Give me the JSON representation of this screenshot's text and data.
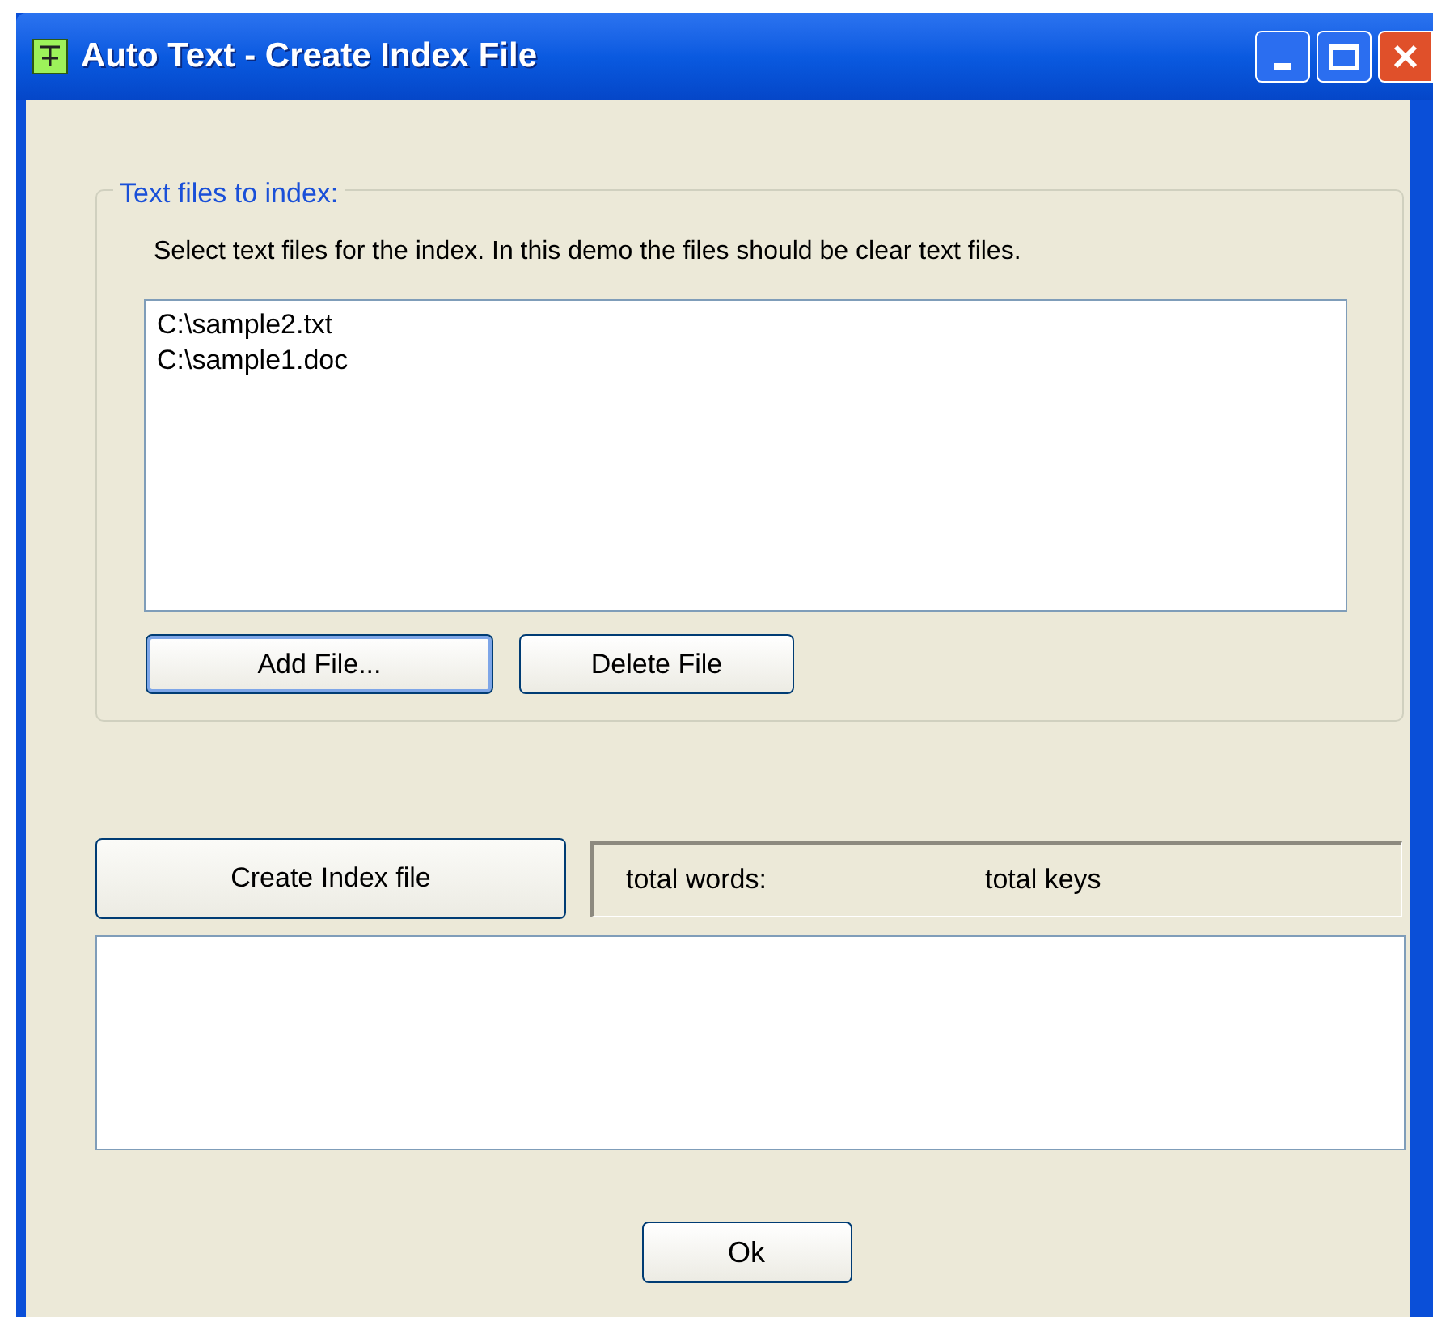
{
  "window": {
    "title": "Auto Text - Create Index File"
  },
  "files_group": {
    "legend": "Text files to index:",
    "description": "Select text files for the index. In this demo the files should be clear text files.",
    "files": [
      "C:\\sample2.txt",
      "C:\\sample1.doc"
    ],
    "buttons": [
      {
        "label": "Add File...",
        "focused": true
      },
      {
        "label": "Delete File",
        "focused": false
      }
    ]
  },
  "create_button": {
    "label": "Create Index file"
  },
  "status": {
    "total_words": "total words:",
    "total_keys": "total keys"
  },
  "ok_button": {
    "label": "Ok"
  }
}
